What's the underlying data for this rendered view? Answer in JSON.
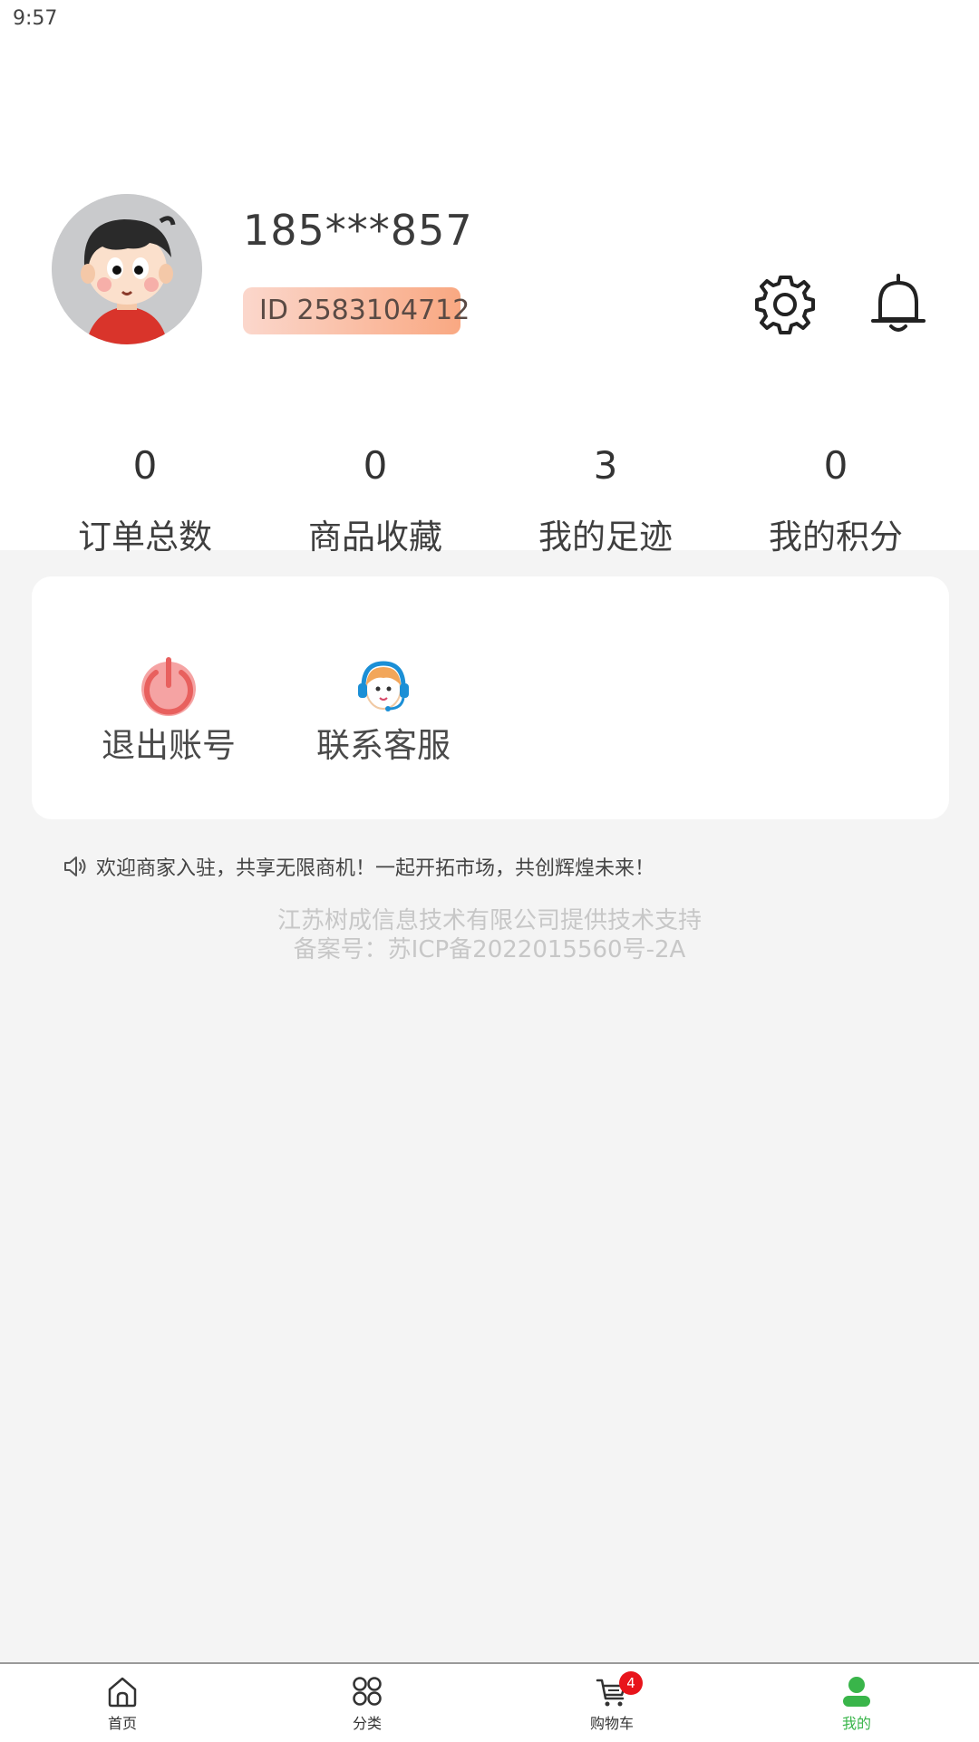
{
  "status_bar": {
    "time": "9:57"
  },
  "profile": {
    "username": "185***857",
    "id_label": "ID 2583104712"
  },
  "stats": [
    {
      "value": "0",
      "label": "订单总数"
    },
    {
      "value": "0",
      "label": "商品收藏"
    },
    {
      "value": "3",
      "label": "我的足迹"
    },
    {
      "value": "0",
      "label": "我的积分"
    }
  ],
  "actions": [
    {
      "label": "退出账号",
      "icon": "power-icon"
    },
    {
      "label": "联系客服",
      "icon": "customer-service-icon"
    }
  ],
  "notice": {
    "icon": "speaker-icon",
    "text": "欢迎商家入驻，共享无限商机！一起开拓市场，共创辉煌未来！"
  },
  "footer": {
    "line1": "江苏树成信息技术有限公司提供技术支持",
    "line2": "备案号：苏ICP备2022015560号-2A"
  },
  "tabs": [
    {
      "label": "首页",
      "icon": "home-icon"
    },
    {
      "label": "分类",
      "icon": "category-icon"
    },
    {
      "label": "购物车",
      "icon": "cart-icon",
      "badge": "4"
    },
    {
      "label": "我的",
      "icon": "user-icon",
      "active": true
    }
  ],
  "colors": {
    "accent_green": "#39b54a",
    "badge_red": "#e8141b",
    "id_badge_start": "#fbd7cc",
    "id_badge_end": "#f9a882",
    "power_icon": "#ef6b6b"
  }
}
